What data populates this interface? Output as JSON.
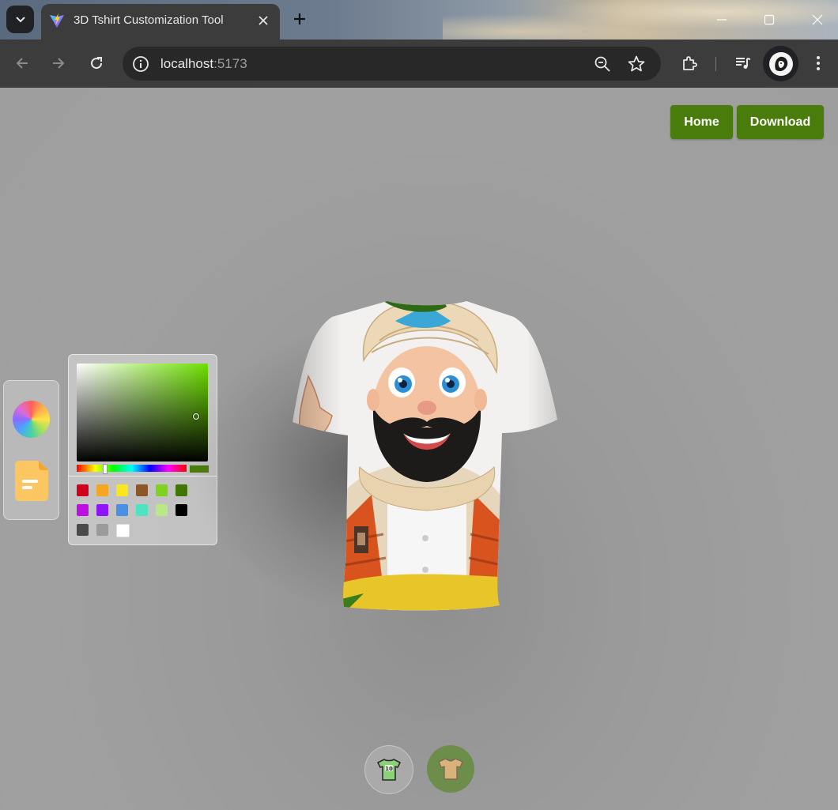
{
  "browser": {
    "tab_title": "3D Tshirt Customization Tool",
    "url_host": "localhost",
    "url_port": ":5173"
  },
  "header": {
    "home_label": "Home",
    "download_label": "Download"
  },
  "colorpicker": {
    "current_color": "#4a7c0c",
    "presets": [
      "#d0021b",
      "#f5a623",
      "#f8e71c",
      "#8b572a",
      "#7ed321",
      "#417505",
      "#bd10e0",
      "#9013fe",
      "#4a90e2",
      "#50e3c2",
      "#b8e986",
      "#000000",
      "#4a4a4a",
      "#9b9b9b",
      "#ffffff"
    ]
  },
  "icons": {
    "side_panel": [
      "color-wheel-icon",
      "file-icon"
    ],
    "bottom": [
      "tshirt-logo-icon",
      "tshirt-full-icon"
    ]
  },
  "colors": {
    "accent": "#4a7c0c"
  }
}
